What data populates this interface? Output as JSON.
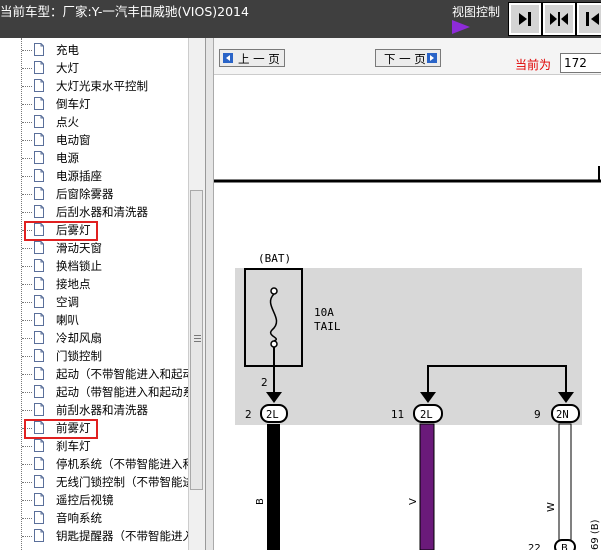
{
  "header": {
    "title": "当前车型：厂家:Y-一汽丰田威驰(VIOS)2014",
    "view_control_label": "视图控制"
  },
  "tree": {
    "items": [
      {
        "label": "充电"
      },
      {
        "label": "大灯"
      },
      {
        "label": "大灯光束水平控制"
      },
      {
        "label": "倒车灯"
      },
      {
        "label": "点火"
      },
      {
        "label": "电动窗"
      },
      {
        "label": "电源"
      },
      {
        "label": "电源插座"
      },
      {
        "label": "后窗除雾器"
      },
      {
        "label": "后刮水器和清洗器"
      },
      {
        "label": "后雾灯"
      },
      {
        "label": "滑动天窗"
      },
      {
        "label": "换档锁止"
      },
      {
        "label": "接地点"
      },
      {
        "label": "空调"
      },
      {
        "label": "喇叭"
      },
      {
        "label": "冷却风扇"
      },
      {
        "label": "门锁控制"
      },
      {
        "label": "起动（不带智能进入和起动"
      },
      {
        "label": "起动（带智能进入和起动系"
      },
      {
        "label": "前刮水器和清洗器"
      },
      {
        "label": "前雾灯"
      },
      {
        "label": "刹车灯"
      },
      {
        "label": "停机系统（不带智能进入和"
      },
      {
        "label": "无线门锁控制（不带智能进"
      },
      {
        "label": "遥控后视镜"
      },
      {
        "label": "音响系统"
      },
      {
        "label": "钥匙提醒器（不带智能进入"
      }
    ]
  },
  "nav": {
    "prev_label": "上 一 页",
    "next_label": "下 一 页",
    "current_label": "当前为",
    "current_value": "172"
  },
  "diagram": {
    "bat_label": "(BAT)",
    "fuse_amp": "10A",
    "fuse_name": "TAIL",
    "pin_left_wire": "2",
    "pin_left": "2",
    "conn_left": "2L",
    "pin_mid": "11",
    "conn_mid": "2L",
    "pin_right": "9",
    "conn_right": "2N",
    "wire_left_color": "B",
    "wire_mid_color": "V",
    "wire_right_color": "W",
    "bottom_pin": "22",
    "bottom_conn": "B",
    "side_label": "69 (B)"
  },
  "colors": {
    "topbar": "#3f3f3f",
    "highlight_box": "#e02020",
    "current_label": "#e00000",
    "violet_wire": "#6a1a7a",
    "panel_gray": "#d8d8d8"
  }
}
